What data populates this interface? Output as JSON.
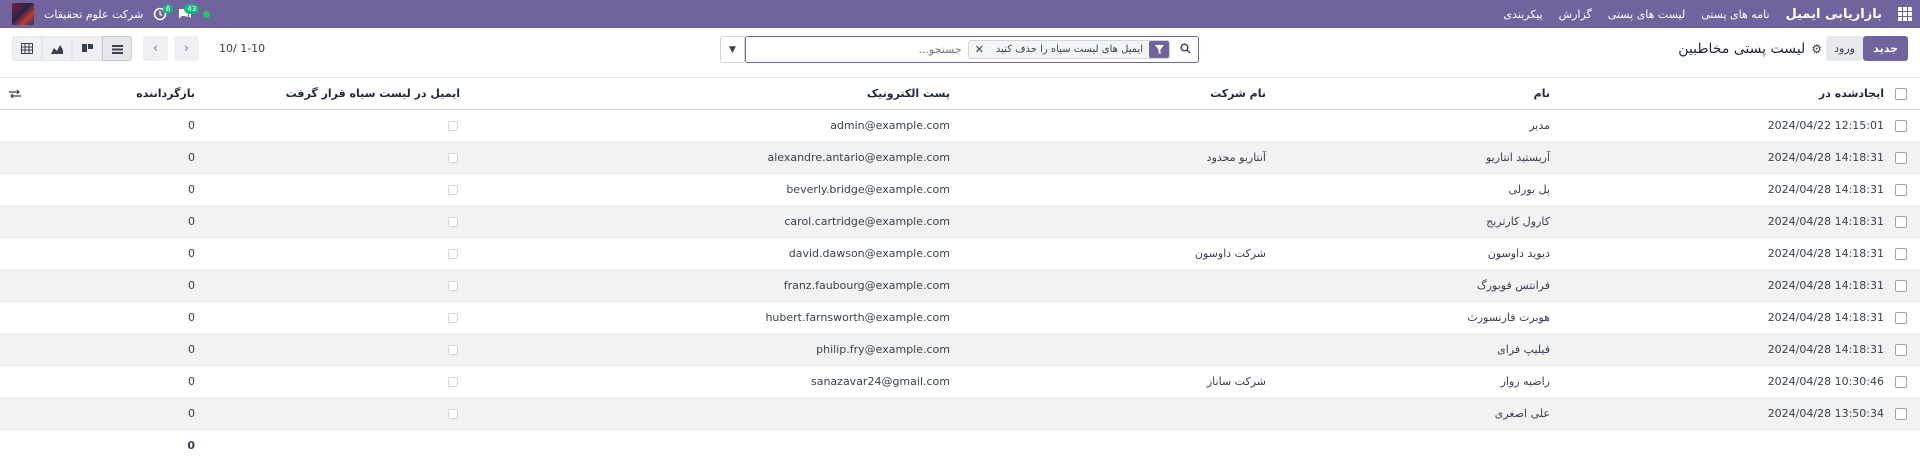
{
  "navbar": {
    "brand": "بازاریابی ایمیل",
    "menu": [
      "نامه های پستی",
      "لیست های پستی",
      "گزارش",
      "پیکربندی"
    ],
    "company": "شرکت علوم تحقیقات",
    "messages_count": "43",
    "activities_count": "6"
  },
  "control": {
    "new_label": "جدید",
    "import_label": "ورود",
    "breadcrumb": "لیست پستی مخاطبین",
    "search_facet": "ایمیل های لیست سیاه را حذف کنید",
    "search_placeholder": "جستجو...",
    "pager_value": "1-10 /10"
  },
  "table": {
    "headers": {
      "created": "ایجادشده در",
      "name": "نام",
      "company": "نام شرکت",
      "email": "پست الکترونیک",
      "blacklisted": "ایمیل در لیست سیاه قرار گرفت",
      "bounce": "بازگرداننده"
    },
    "rows": [
      {
        "created": "2024/04/22 12:15:01",
        "name": "مدیر",
        "company": "",
        "email": "admin@example.com",
        "bounce": "0"
      },
      {
        "created": "2024/04/28 14:18:31",
        "name": "آریستید انتاریو",
        "company": "آنتاریو محدود",
        "email": "alexandre.antario@example.com",
        "bounce": "0"
      },
      {
        "created": "2024/04/28 14:18:31",
        "name": "پل بورلی",
        "company": "",
        "email": "beverly.bridge@example.com",
        "bounce": "0"
      },
      {
        "created": "2024/04/28 14:18:31",
        "name": "کارول کارتریج",
        "company": "",
        "email": "carol.cartridge@example.com",
        "bounce": "0"
      },
      {
        "created": "2024/04/28 14:18:31",
        "name": "دیوید داوسون",
        "company": "شرکت داوسون",
        "email": "david.dawson@example.com",
        "bounce": "0"
      },
      {
        "created": "2024/04/28 14:18:31",
        "name": "فرانتس فوبورگ",
        "company": "",
        "email": "franz.faubourg@example.com",
        "bounce": "0"
      },
      {
        "created": "2024/04/28 14:18:31",
        "name": "هوبرت فارنسورث",
        "company": "",
        "email": "hubert.farnsworth@example.com",
        "bounce": "0"
      },
      {
        "created": "2024/04/28 14:18:31",
        "name": "فیلیپ فرای",
        "company": "",
        "email": "philip.fry@example.com",
        "bounce": "0"
      },
      {
        "created": "2024/04/28 10:30:46",
        "name": "راضیه زوار",
        "company": "شرکت ساناز",
        "email": "sanazavar24@gmail.com",
        "bounce": "0"
      },
      {
        "created": "2024/04/28 13:50:34",
        "name": "علی اصغری",
        "company": "",
        "email": "",
        "bounce": "0"
      }
    ],
    "footer_total": "0"
  },
  "colors": {
    "accent": "#71639e",
    "row_alt": "#f2f2f2"
  },
  "icons": [
    "apps-icon",
    "settings-gear-icon",
    "search-icon",
    "filter-icon",
    "close-icon",
    "caret-down-icon",
    "chevron-left-icon",
    "chevron-right-icon",
    "list-view-icon",
    "kanban-view-icon",
    "graph-view-icon",
    "pivot-view-icon",
    "column-options-icon",
    "chat-icon",
    "activity-clock-icon"
  ]
}
